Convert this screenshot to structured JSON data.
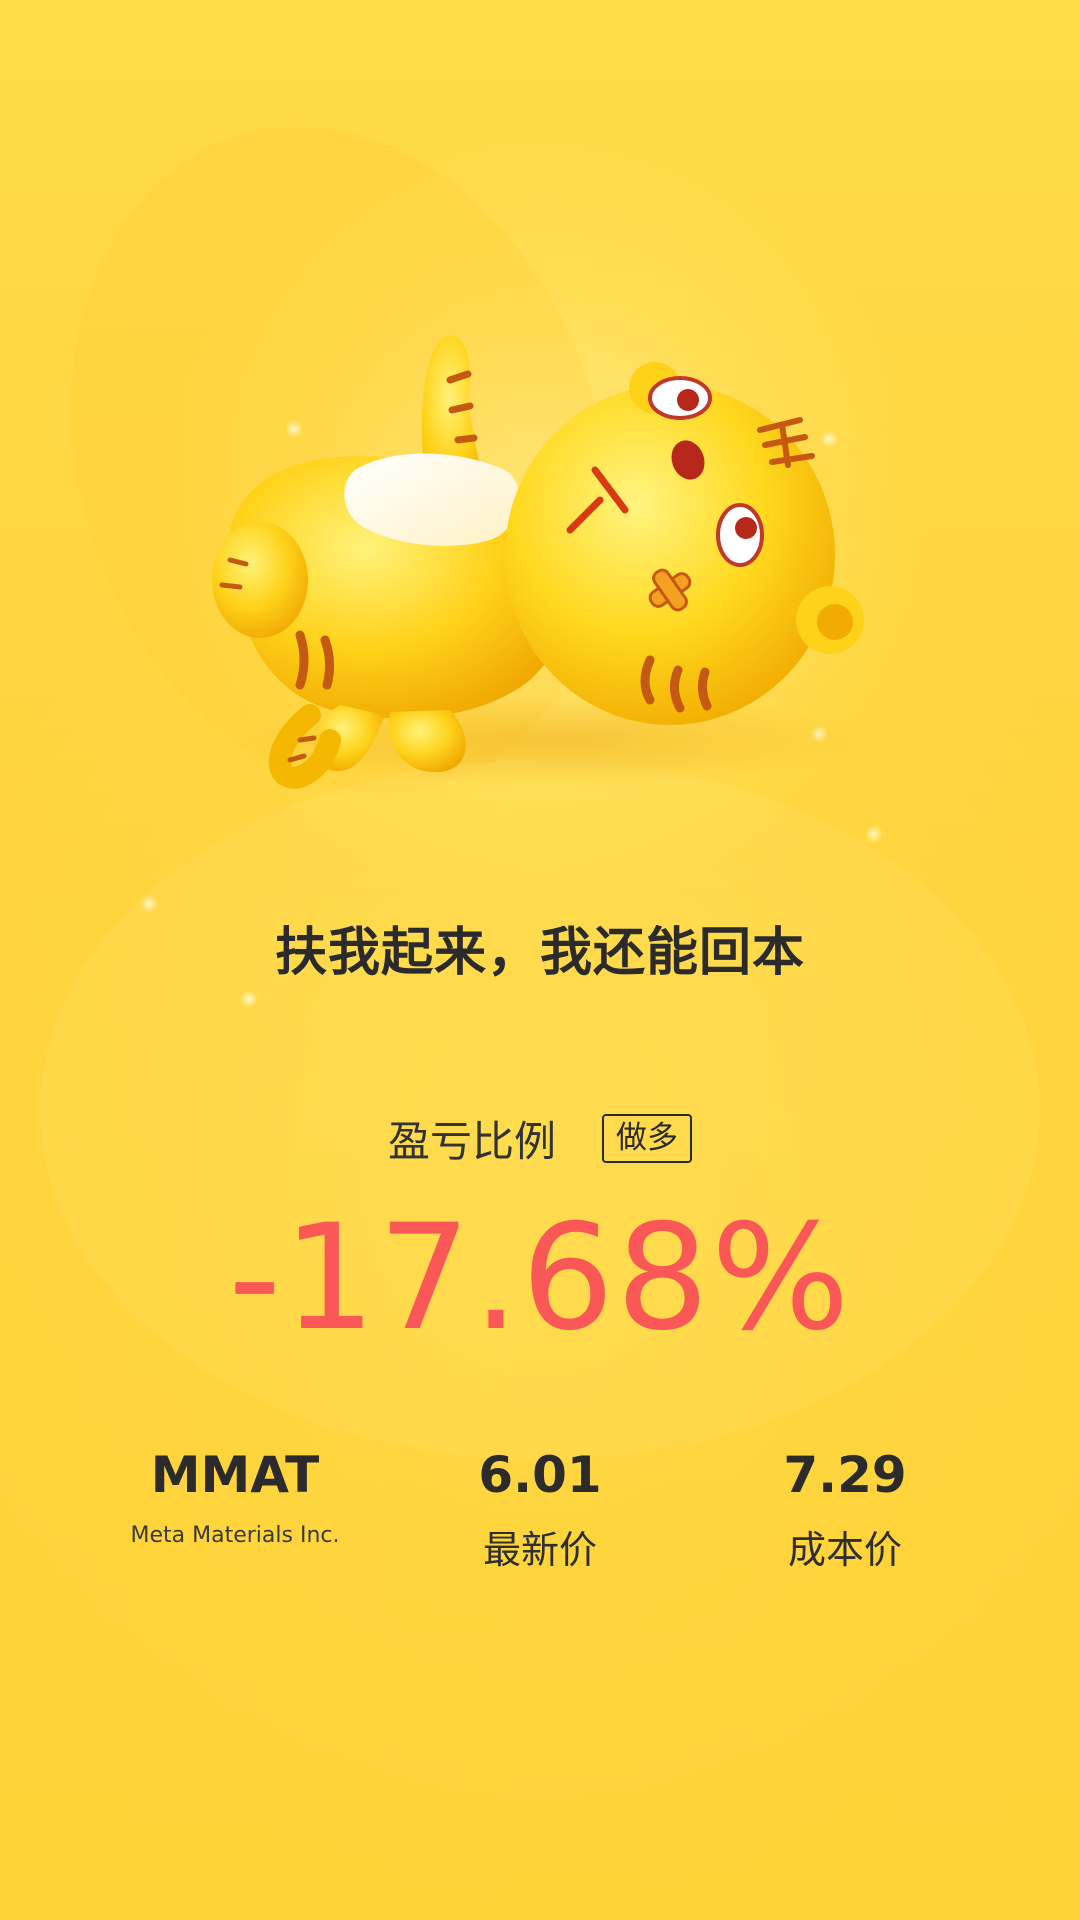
{
  "slogan": "扶我起来，我还能回本",
  "ratio": {
    "label": "盈亏比例",
    "direction": "做多",
    "percent": "-17.68%",
    "percent_color": "#fa5757"
  },
  "stock": {
    "symbol": "MMAT",
    "name": "Meta Materials Inc."
  },
  "latest": {
    "value": "6.01",
    "label": "最新价"
  },
  "cost": {
    "value": "7.29",
    "label": "成本价"
  },
  "theme": {
    "background": "#ffd23a",
    "text": "#2b2b2b"
  },
  "mascot": {
    "icon": "fallen-tiger-mascot-icon"
  }
}
